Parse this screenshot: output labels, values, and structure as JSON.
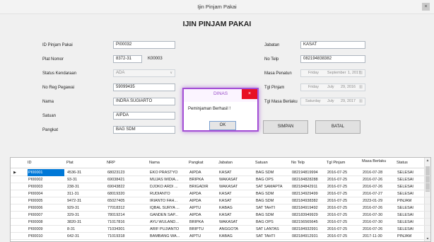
{
  "window": {
    "title": "Ijin Pinjam Pakai",
    "close_glyph": "×"
  },
  "header": "IJIN PINJAM PAKAI",
  "form": {
    "id_label": "ID Pinjam Pakai",
    "id_value": "PI00032",
    "plat_label": "Plat Nomor",
    "plat_value": "8372-31",
    "plat_code": "K00003",
    "status_label": "Status Kendaraan",
    "status_value": "ADA",
    "nrp_label": "No Reg Pegawai",
    "nrp_value": "59099435",
    "nama_label": "Nama",
    "nama_value": "INDRA SUGIARTO",
    "satuan_label": "Satuan",
    "satuan_value": "AIPDA",
    "pangkat_label": "Pangkat",
    "pangkat_value": "BAG SDM",
    "jabatan_label": "Jabatan",
    "jabatan_value": "KASAT",
    "telp_label": "No Telp",
    "telp_value": "082194838382",
    "penetun_label": "Masa Penatun",
    "penetun_day": "Friday",
    "penetun_month": "September",
    "penetun_date": "1, 2017",
    "pinjam_label": "Tgl Pinjam",
    "pinjam_day": "Friday",
    "pinjam_month": "July",
    "pinjam_date": "29, 2016",
    "berlaku_label": "Tgl Masa Berlaku",
    "berlaku_day": "Saturday",
    "berlaku_month": "July",
    "berlaku_date": "29, 2017"
  },
  "buttons": {
    "simpan": "SIMPAN",
    "batal": "BATAL"
  },
  "dialog": {
    "title": "DINAS",
    "message": "Peminjaman Berhasil !",
    "ok": "OK"
  },
  "icons": {
    "calendar": "calendar-icon",
    "dropdown": "chevron-down-icon",
    "close": "close-icon",
    "row_pointer": "row-pointer-icon"
  },
  "colors": {
    "dialog_border": "#a44fd6",
    "close_red": "#e81123",
    "selection": "#0078d7"
  },
  "table": {
    "columns": [
      "ID",
      "Plat",
      "NRP",
      "Nama",
      "Pangkat",
      "Jabatan",
      "Satuan",
      "No Telp",
      "Tgl Pinjam",
      "Masa Berlaku",
      "Status"
    ],
    "rows": [
      [
        "PI00001",
        "4536-31",
        "68023123",
        "EKO PRASTYO",
        "AIPDA",
        "KASAT",
        "BAG SDM",
        "082194819994",
        "2016-07-25",
        "2016-07-28",
        "SELESAI"
      ],
      [
        "PI00002",
        "93-31",
        "69038421",
        "MUJAS WIDIA...",
        "BRIPKA",
        "WAKASAT",
        "BAG OPS",
        "082184828288",
        "2016-07-25",
        "2016-07-26",
        "SELESAI"
      ],
      [
        "PI00003",
        "238-31",
        "69043822",
        "DJOKO ARDI ...",
        "BRIGADIR",
        "WAKASAT",
        "SAT SAMAPTA",
        "082184842911",
        "2016-07-25",
        "2016-07-26",
        "SELESAI"
      ],
      [
        "PI00004",
        "311-31",
        "68019320",
        "RUDIANTO",
        "AIPDA",
        "KASAT",
        "BAG SDM",
        "082134929499",
        "2016-07-25",
        "2016-07-27",
        "SELESAI"
      ],
      [
        "PI00005",
        "9472-31",
        "65027405",
        "IRIANTO FAH...",
        "AIPDA",
        "KASAT",
        "BAG SDM",
        "082184938382",
        "2016-07-25",
        "2023-01-29",
        "PINJAM"
      ],
      [
        "PI00006",
        "929-31",
        "77018312",
        "IQBAL SURYA ...",
        "AIPTU",
        "KABAG",
        "SAT TAHTI",
        "082184919492",
        "2016-07-25",
        "2016-07-26",
        "SELESAI"
      ],
      [
        "PI00007",
        "329-31",
        "78019214",
        "GANDEN SAP...",
        "AIPDA",
        "KASAT",
        "BAG SDM",
        "082183949929",
        "2016-07-25",
        "2016-07-30",
        "SELESAI"
      ],
      [
        "PI00008",
        "3820-31",
        "71017816",
        "AYU WULAND...",
        "BRIPKA",
        "WAKASAT",
        "BAG OPS",
        "082156565645",
        "2016-07-25",
        "2016-07-30",
        "SELESAI"
      ],
      [
        "PI00009",
        "8-31",
        "71034301",
        "ARIF PUJIANTO",
        "BRIPTU",
        "ANGGOTA",
        "SAT LANTAS",
        "082184932991",
        "2016-07-25",
        "2016-07-26",
        "SELESAI"
      ],
      [
        "PI00010",
        "642-31",
        "71019318",
        "BAMBANG WA...",
        "AIPTU",
        "KABAG",
        "SAT TAHTI",
        "082184912931",
        "2016-07-25",
        "2017-11-30",
        "PINJAM"
      ],
      [
        "PI00011",
        "948-31",
        "78028410",
        "SUMIADI BER...",
        "BRIPTU",
        "KASI",
        "SI PROPAM",
        "082174839292",
        "2016-07-25",
        "2017-07-28",
        "PINJAM"
      ]
    ]
  }
}
